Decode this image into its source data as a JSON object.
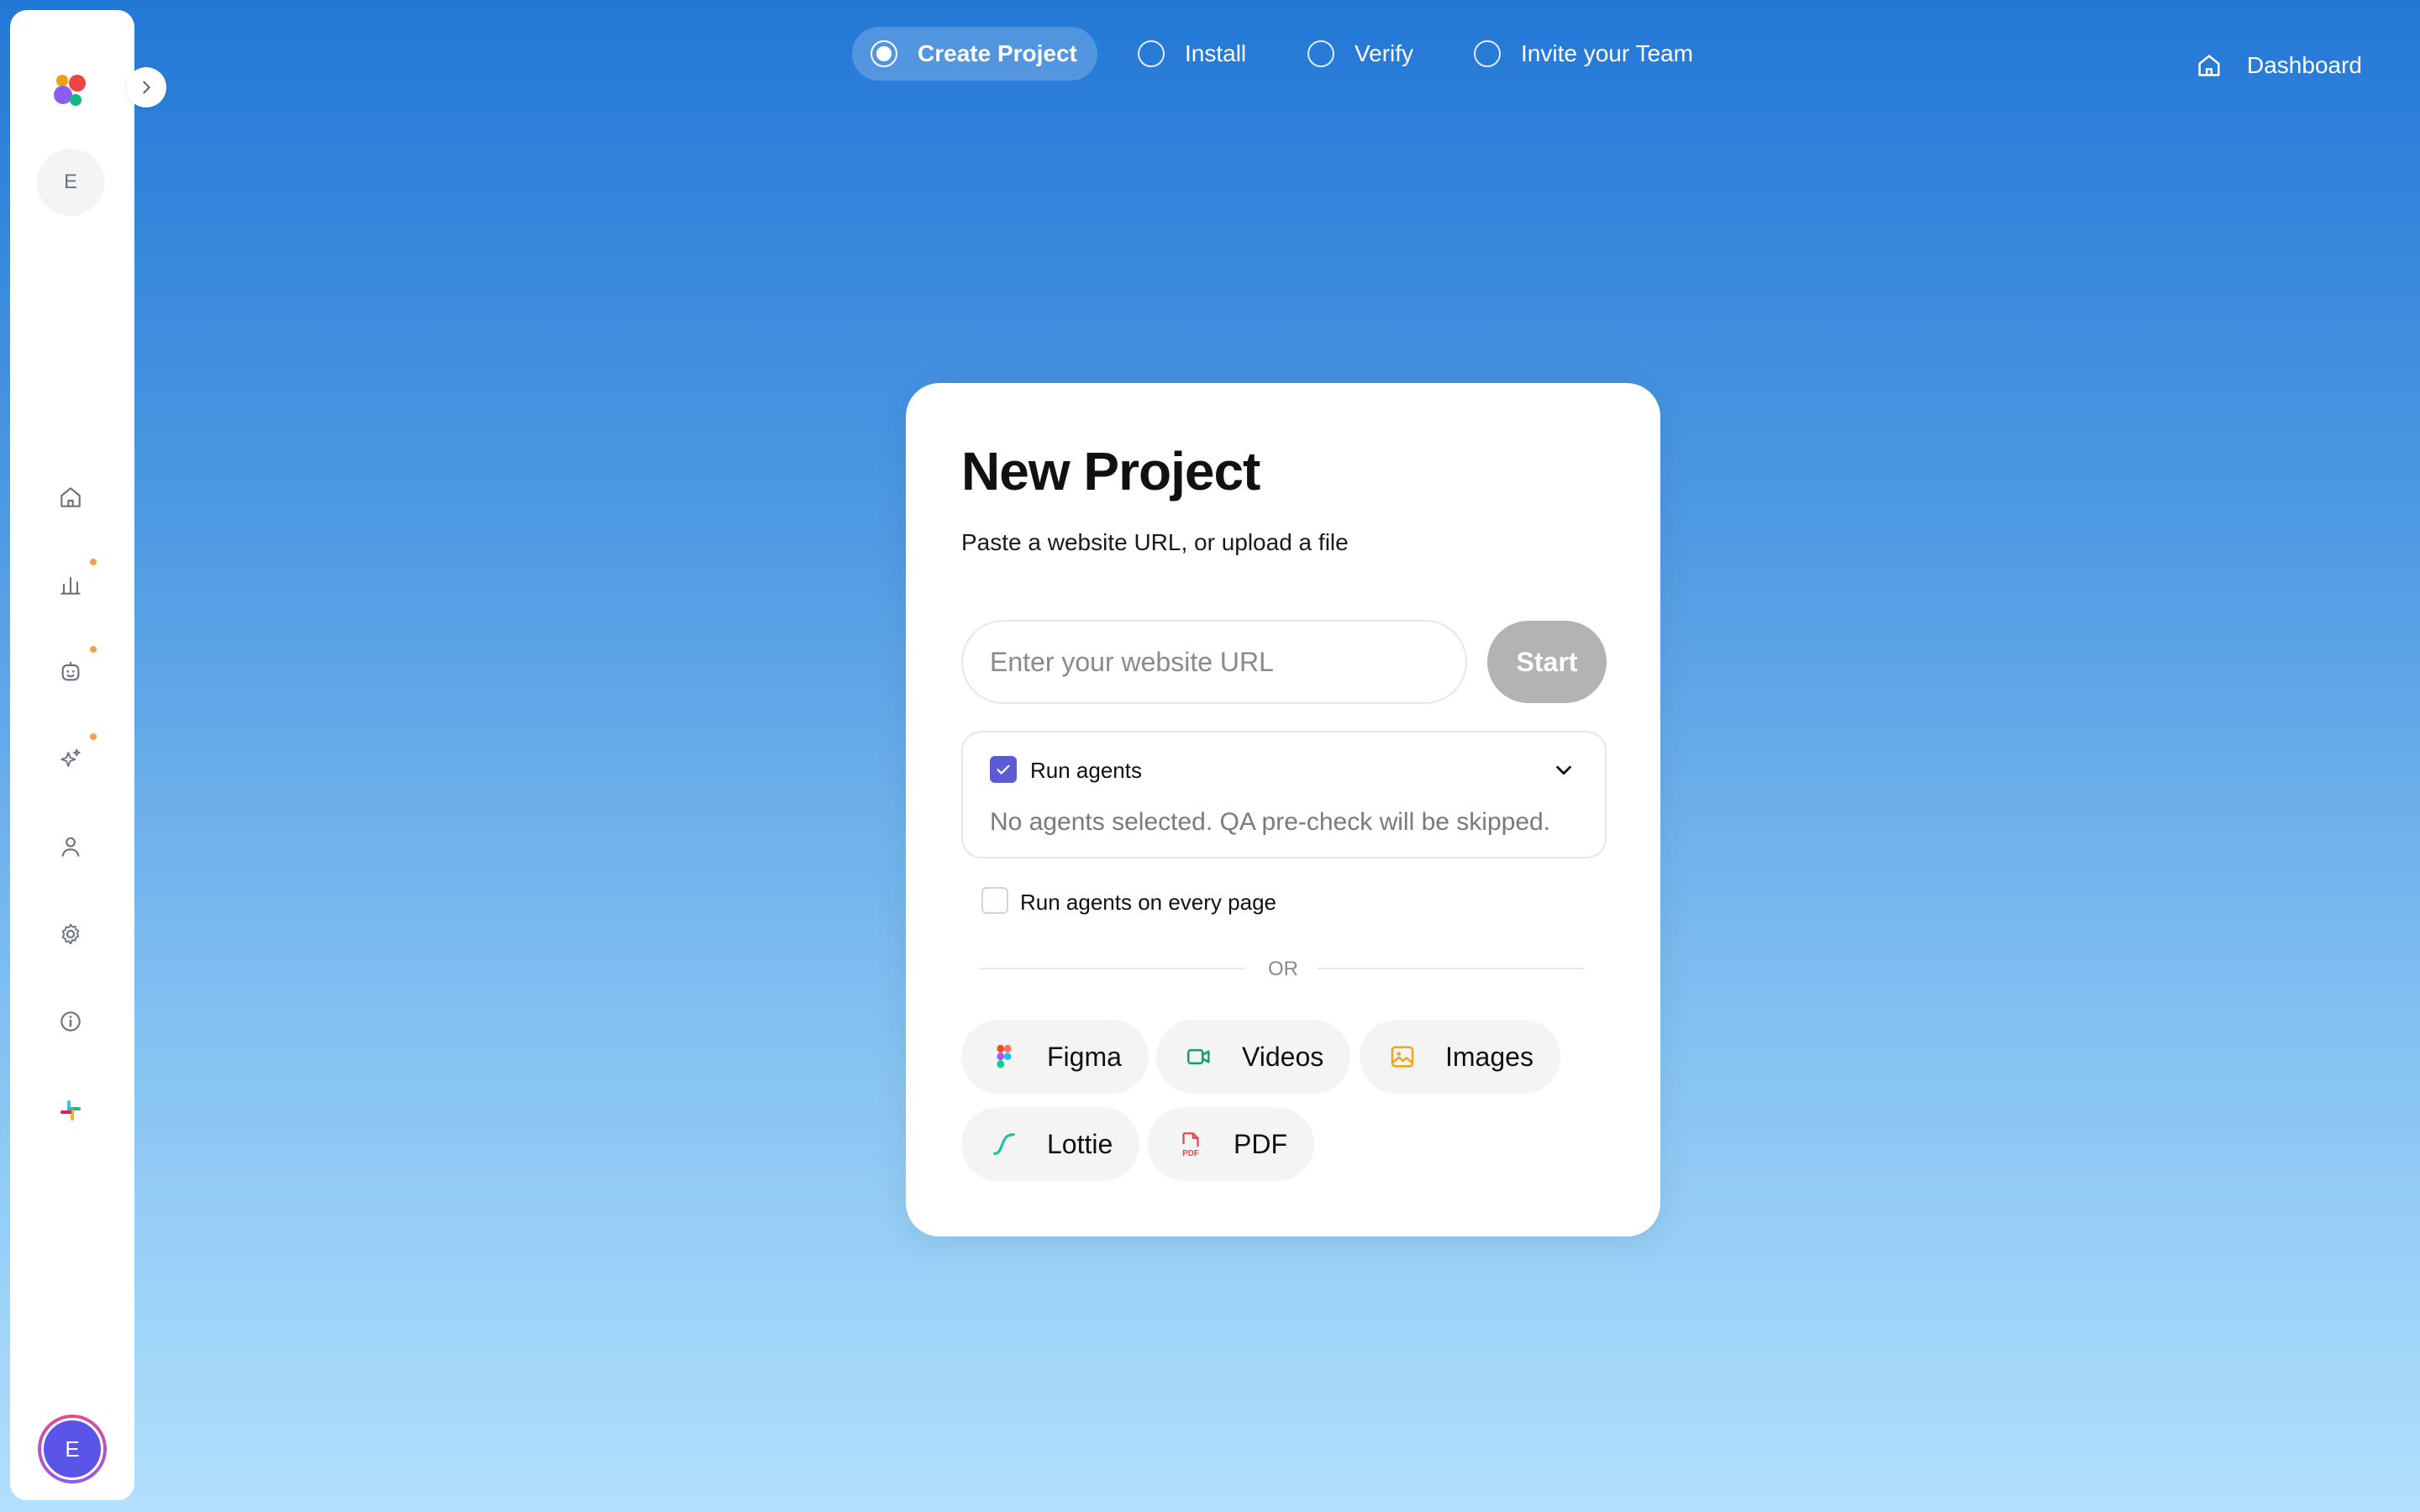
{
  "sidebar": {
    "workspace_initial": "E",
    "user_initial": "E",
    "nav_icons": [
      "home-icon",
      "analytics-icon",
      "agent-bot-icon",
      "sparkles-icon",
      "user-icon",
      "settings-icon",
      "info-icon",
      "slack-icon"
    ],
    "new_dot_color": "#f59f4a"
  },
  "stepper": {
    "steps": [
      {
        "label": "Create Project",
        "state": "active"
      },
      {
        "label": "Install",
        "state": "pending"
      },
      {
        "label": "Verify",
        "state": "pending"
      },
      {
        "label": "Invite your Team",
        "state": "pending"
      }
    ]
  },
  "header": {
    "dashboard_label": "Dashboard"
  },
  "card": {
    "title": "New Project",
    "subtitle": "Paste a website URL, or upload a file",
    "url_input": {
      "value": "",
      "placeholder": "Enter your website URL"
    },
    "start_label": "Start",
    "agents": {
      "label": "Run agents",
      "checked": true,
      "status": "No agents selected. QA pre-check will be skipped."
    },
    "every_page": {
      "label": "Run agents on every page",
      "checked": false
    },
    "divider_text": "OR",
    "uploads": [
      {
        "label": "Figma",
        "icon": "figma-icon"
      },
      {
        "label": "Videos",
        "icon": "video-icon"
      },
      {
        "label": "Images",
        "icon": "image-icon"
      },
      {
        "label": "Lottie",
        "icon": "lottie-icon"
      },
      {
        "label": "PDF",
        "icon": "pdf-icon"
      }
    ]
  },
  "colors": {
    "accent": "#5b5bd6",
    "avatar": "#5a55e8",
    "start_disabled": "#b3b3b3"
  }
}
